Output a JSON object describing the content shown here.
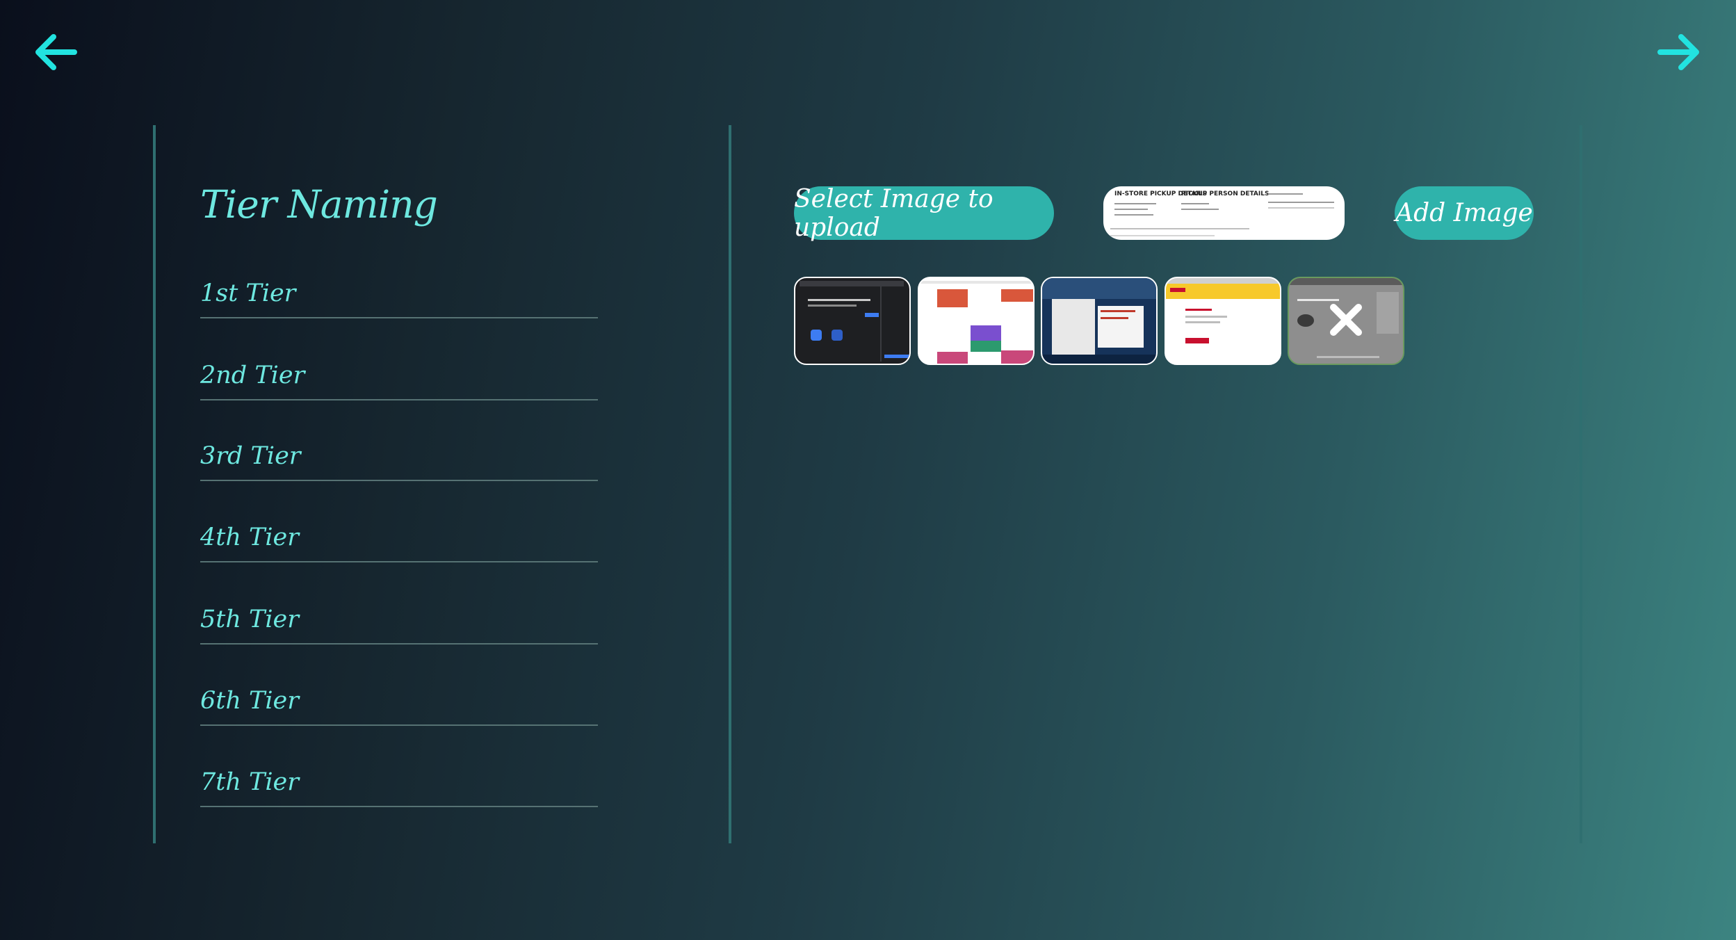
{
  "nav": {
    "back_icon": "arrow-left-icon",
    "forward_icon": "arrow-right-icon",
    "accent": "#22e3e0"
  },
  "tier_section": {
    "title": "Tier Naming",
    "tiers": [
      "1st Tier",
      "2nd Tier",
      "3rd Tier",
      "4th Tier",
      "5th Tier",
      "6th Tier",
      "7th Tier"
    ]
  },
  "upload": {
    "select_label": "Select Image to upload",
    "add_label": "Add Image",
    "preview_headers": [
      "IN-STORE PICKUP DETAILS",
      "PICKUP PERSON DETAILS"
    ],
    "thumbnail_count": 5,
    "remove_icon": "close-x-icon"
  },
  "colors": {
    "title_text": "#6ee8e0",
    "button_bg": "#2fb3ab",
    "divider": "#2f6f70"
  }
}
